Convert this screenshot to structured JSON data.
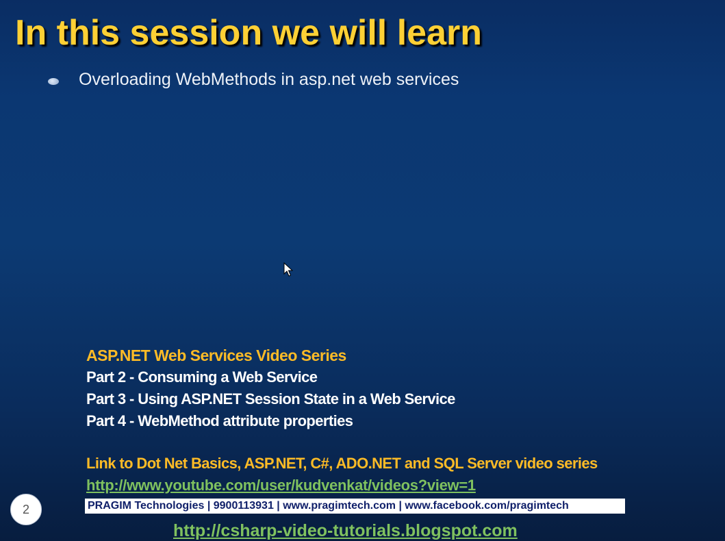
{
  "slide": {
    "title": "In this session we will learn",
    "bullets": [
      "Overloading WebMethods in asp.net web services"
    ],
    "number": "2"
  },
  "series": {
    "title": "ASP.NET Web Services Video Series",
    "parts": [
      "Part 2 - Consuming a Web Service",
      "Part 3 - Using ASP.NET Session State in a Web Service",
      "Part 4 - WebMethod attribute properties"
    ]
  },
  "links": {
    "heading": "Link to Dot Net Basics, ASP.NET, C#, ADO.NET and SQL Server video series",
    "youtube": "http://www.youtube.com/user/kudvenkat/videos?view=1",
    "pragim_bar": "PRAGIM Technologies | 9900113931 | www.pragimtech.com | www.facebook.com/pragimtech",
    "blog": "http://csharp-video-tutorials.blogspot.com"
  },
  "colors": {
    "title": "#fdd035",
    "series_heading": "#fdbb26",
    "link": "#7fc15f",
    "background": "#0b3772"
  },
  "icons": {
    "bullet": "oval-bullet-icon",
    "pointer": "mouse-pointer-icon"
  }
}
